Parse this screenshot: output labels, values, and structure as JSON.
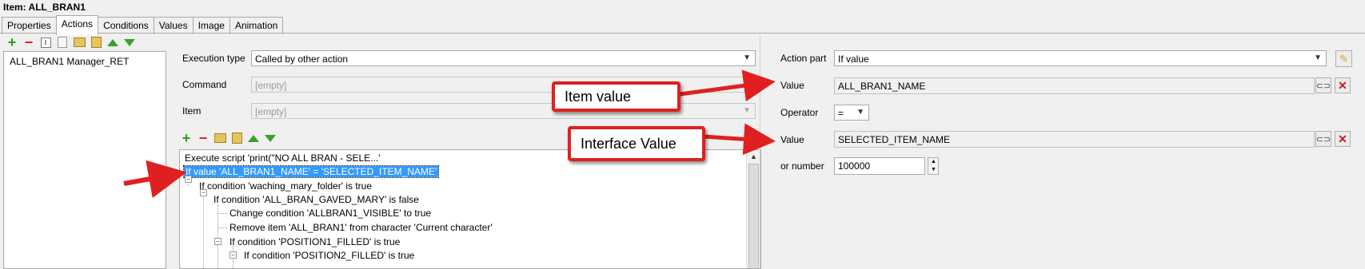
{
  "window": {
    "title": "Item: ALL_BRAN1"
  },
  "tabs": [
    "Properties",
    "Actions",
    "Conditions",
    "Values",
    "Image",
    "Animation"
  ],
  "left_list": {
    "items": [
      "ALL_BRAN1 Manager_RET"
    ]
  },
  "execution": {
    "type_label": "Execution type",
    "type_value": "Called by other action",
    "command_label": "Command",
    "command_value": "[empty]",
    "item_label": "Item",
    "item_value": "[empty]"
  },
  "action_tree": [
    "Execute script 'print(\"NO ALL BRAN - SELE...'",
    "If value 'ALL_BRAN1_NAME' = 'SELECTED_ITEM_NAME'",
    "If condition 'waching_mary_folder' is true",
    "If condition 'ALL_BRAN_GAVED_MARY' is false",
    "Change condition 'ALLBRAN1_VISIBLE' to true",
    "Remove item 'ALL_BRAN1' from character 'Current character'",
    "If condition 'POSITION1_FILLED' is true",
    "If condition 'POSITION2_FILLED' is true"
  ],
  "right": {
    "action_part_label": "Action part",
    "action_part_value": "If value",
    "value1_label": "Value",
    "value1": "ALL_BRAN1_NAME",
    "operator_label": "Operator",
    "operator_value": "=",
    "value2_label": "Value",
    "value2": "SELECTED_ITEM_NAME",
    "or_number_label": "or number",
    "or_number_value": "100000"
  },
  "annotations": {
    "item_value": "Item value",
    "interface_value": "Interface Value"
  },
  "colors": {
    "accent_red": "#e02020",
    "selection": "#3399ff",
    "add_green": "#2f9a1e"
  }
}
